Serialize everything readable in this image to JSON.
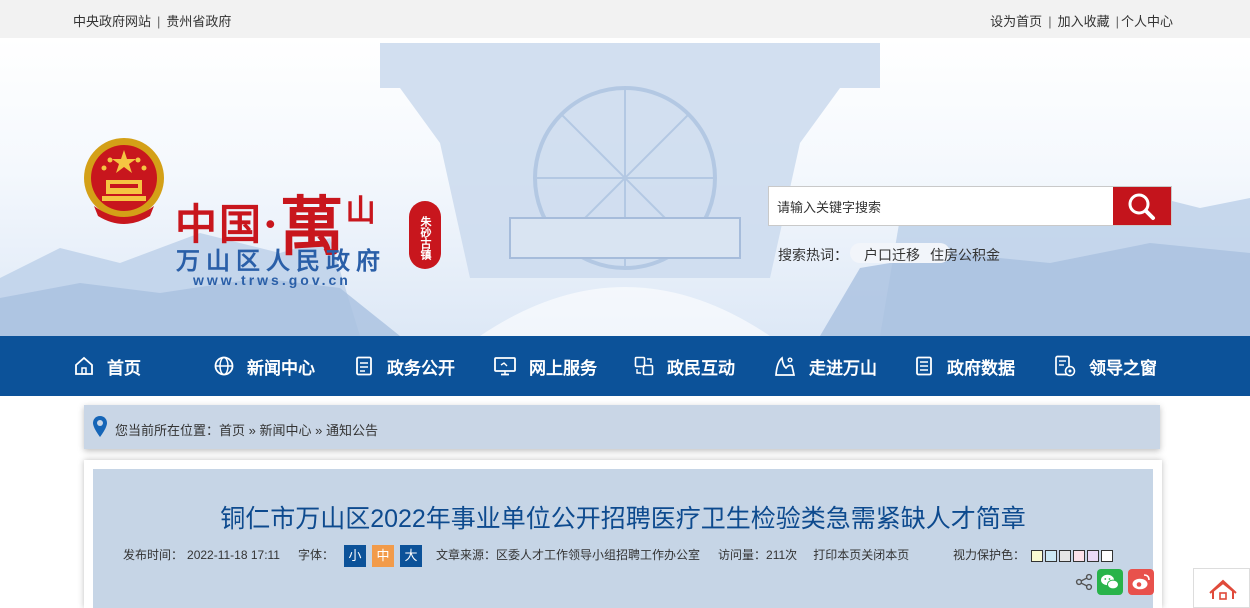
{
  "topbar": {
    "left_links": [
      "中央政府网站",
      "贵州省政府"
    ],
    "right_links": [
      "设为首页",
      "加入收藏",
      "个人中心"
    ]
  },
  "header": {
    "logo_cn": "中国",
    "logo_dot": "·",
    "logo_wan": "萬",
    "logo_shan": "山",
    "logo_sub": "万山区人民政府",
    "logo_url": "www.trws.gov.cn",
    "seal_text": "朱砂古镇"
  },
  "search": {
    "placeholder": "请输入关键字搜索",
    "hot_label": "搜索热词：",
    "hot_words": [
      "户口迁移",
      "住房公积金"
    ]
  },
  "nav": {
    "items": [
      {
        "label": "首页",
        "icon": "home-icon"
      },
      {
        "label": "新闻中心",
        "icon": "globe-icon"
      },
      {
        "label": "政务公开",
        "icon": "document-icon"
      },
      {
        "label": "网上服务",
        "icon": "monitor-icon"
      },
      {
        "label": "政民互动",
        "icon": "interaction-icon"
      },
      {
        "label": "走进万山",
        "icon": "mountain-icon"
      },
      {
        "label": "政府数据",
        "icon": "data-icon"
      },
      {
        "label": "领导之窗",
        "icon": "leader-icon"
      }
    ]
  },
  "breadcrumb": {
    "prefix": "您当前所在位置：",
    "items": [
      "首页",
      "新闻中心",
      "通知公告"
    ],
    "separator": "»"
  },
  "article": {
    "title": "铜仁市万山区2022年事业单位公开招聘医疗卫生检验类急需紧缺人才简章",
    "publish_label": "发布时间：",
    "publish_time": "2022-11-18 17:11",
    "font_label": "字体：",
    "font_sizes": [
      "小",
      "中",
      "大"
    ],
    "source_label": "文章来源：",
    "source": "区委人才工作领导小组招聘工作办公室",
    "views_label": "访问量：",
    "views": "211次",
    "print": "打印本页",
    "close": "关闭本页",
    "vision_label": "视力保护色："
  },
  "colors": {
    "nav_bg": "#0c5299",
    "brand_red": "#c8161d",
    "font_small": "#0c5299",
    "font_mid": "#f29b4a",
    "font_large": "#0c5299",
    "vision_swatches": [
      "#fafad2",
      "#cce8f4",
      "#e6e6e6",
      "#fde2ea",
      "#ead9f5",
      "#ffffff"
    ],
    "wechat": "#28b34a",
    "weibo": "#e8514c"
  }
}
